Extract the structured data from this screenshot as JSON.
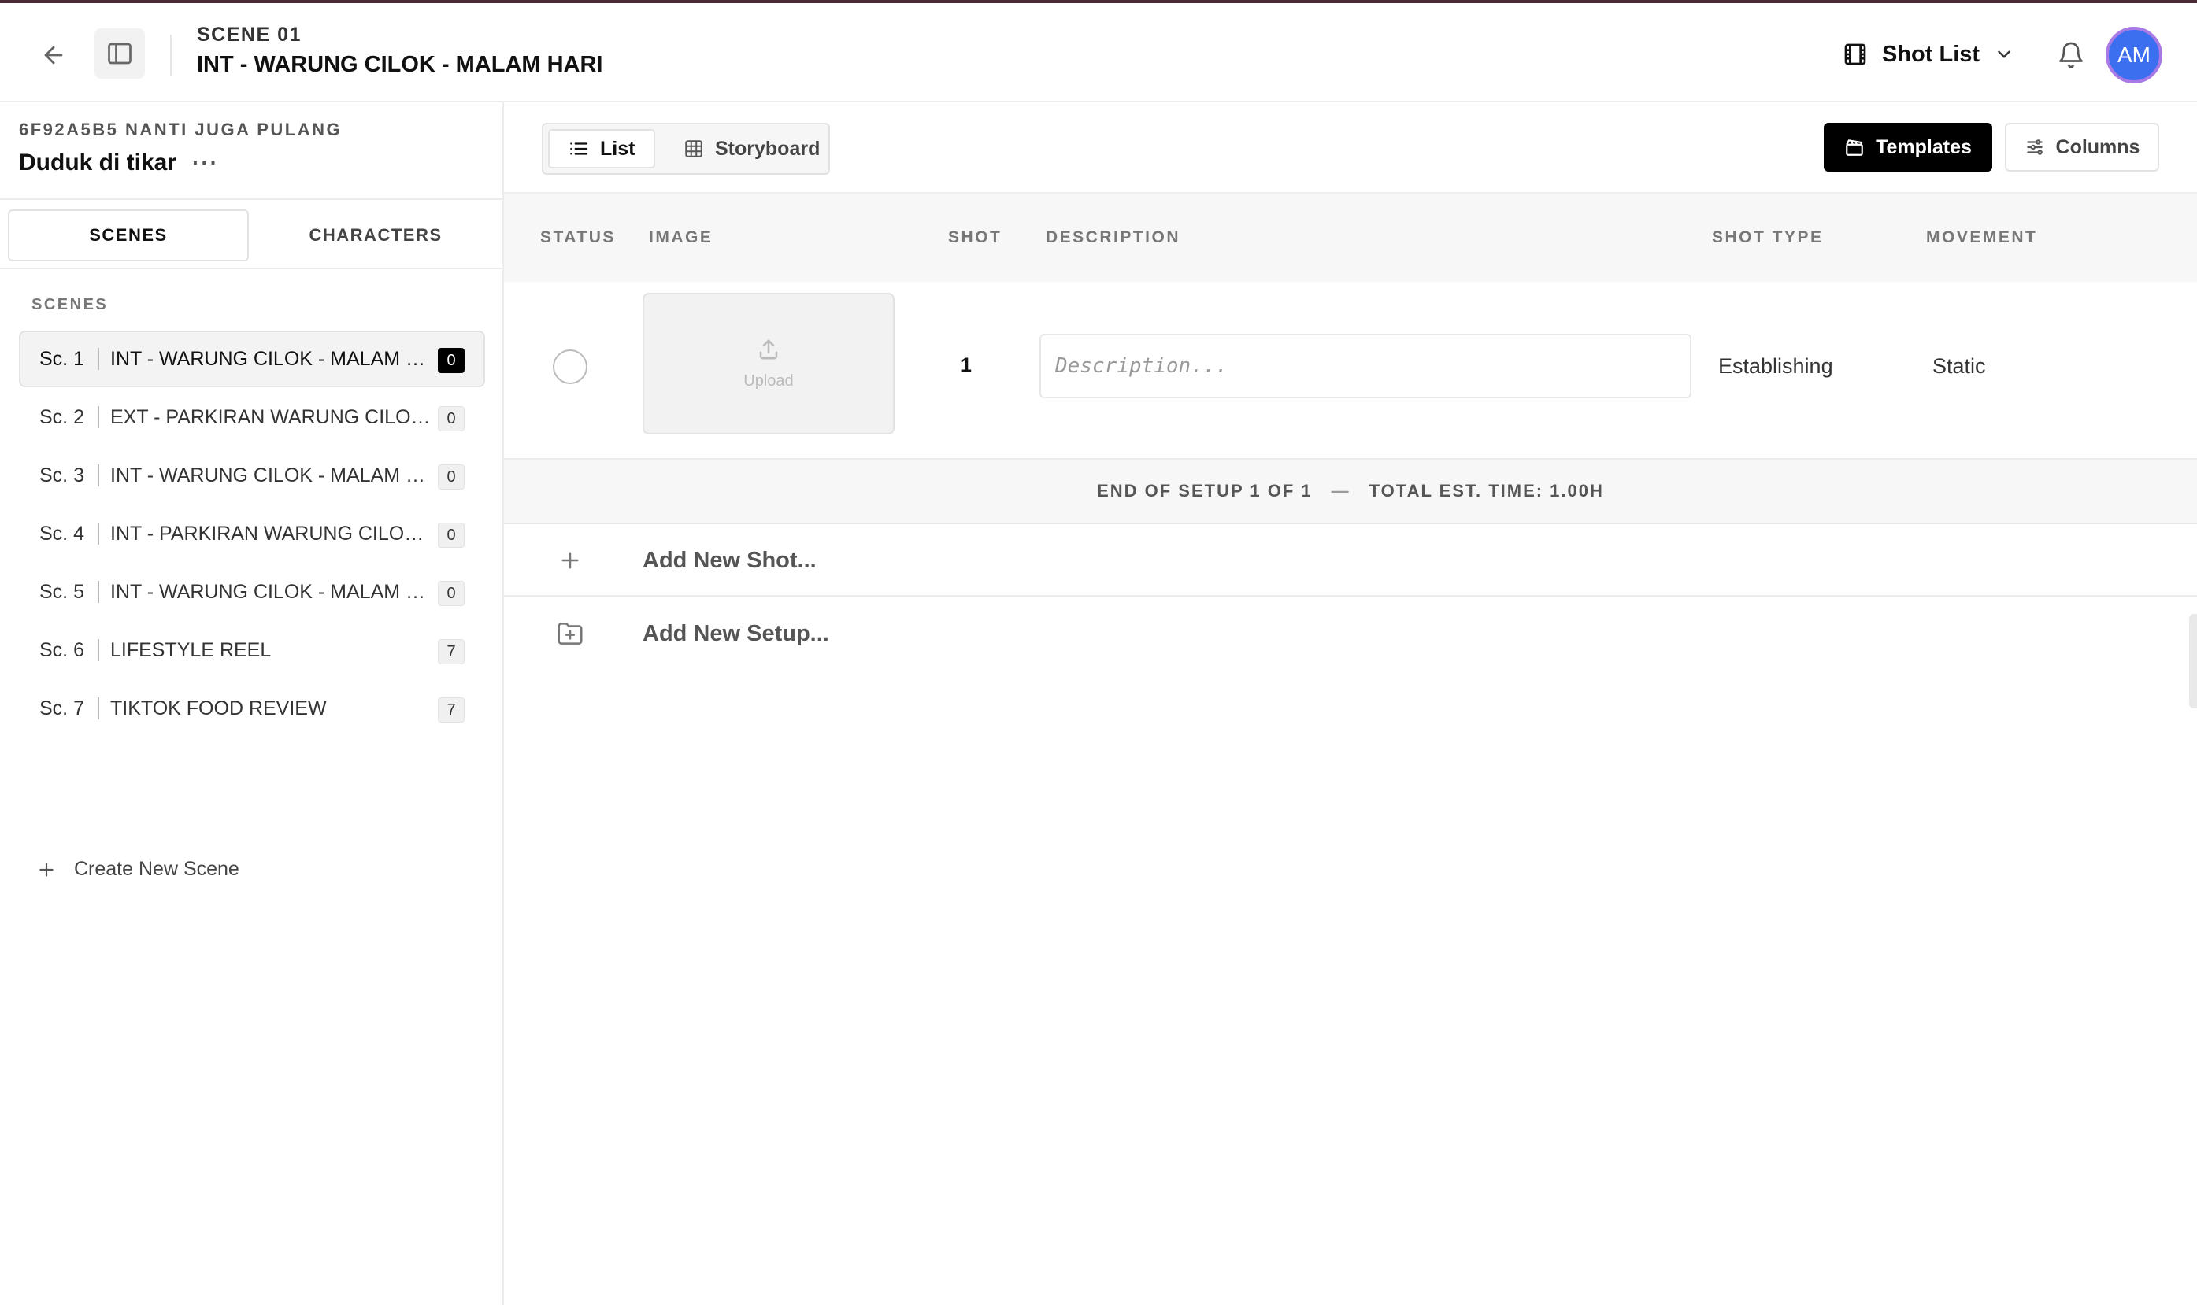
{
  "header": {
    "scene_label": "SCENE 01",
    "scene_heading": "INT - WARUNG CILOK - MALAM HARI",
    "view_dropdown": "Shot List",
    "avatar_initials": "AM"
  },
  "sidebar": {
    "project_id": "6F92A5B5 NANTI JUGA PULANG",
    "project_name": "Duduk di tikar",
    "more": "···",
    "tabs": [
      "SCENES",
      "CHARACTERS"
    ],
    "scenes_caption": "SCENES",
    "scenes": [
      {
        "num": "Sc. 1",
        "title": "INT - WARUNG CILOK - MALAM H...",
        "count": "0"
      },
      {
        "num": "Sc. 2",
        "title": "EXT - PARKIRAN WARUNG CILOT ...",
        "count": "0"
      },
      {
        "num": "Sc. 3",
        "title": "INT - WARUNG CILOK - MALAM H...",
        "count": "0"
      },
      {
        "num": "Sc. 4",
        "title": "INT - PARKIRAN WARUNG CILOK ...",
        "count": "0"
      },
      {
        "num": "Sc. 5",
        "title": "INT - WARUNG CILOK - MALAM H...",
        "count": "0"
      },
      {
        "num": "Sc. 6",
        "title": "LIFESTYLE REEL",
        "count": "7"
      },
      {
        "num": "Sc. 7",
        "title": "TIKTOK FOOD REVIEW",
        "count": "7"
      }
    ],
    "create_scene": "Create New Scene"
  },
  "toolbar": {
    "list_label": "List",
    "storyboard_label": "Storyboard",
    "templates_label": "Templates",
    "columns_label": "Columns"
  },
  "table": {
    "headers": {
      "status": "STATUS",
      "image": "IMAGE",
      "shot": "SHOT",
      "description": "DESCRIPTION",
      "shot_type": "SHOT TYPE",
      "movement": "MOVEMENT"
    },
    "rows": [
      {
        "upload_label": "Upload",
        "shot": "1",
        "description_placeholder": "Description...",
        "shot_type": "Establishing",
        "movement": "Static"
      }
    ],
    "setup_footer_left": "END OF SETUP 1 OF 1",
    "setup_footer_sep": "—",
    "setup_footer_right": "TOTAL EST. TIME: 1.00H",
    "add_shot": "Add New Shot...",
    "add_setup": "Add New Setup..."
  },
  "colors": {
    "accent_black": "#000000",
    "avatar_bg": "#3b6ff0",
    "avatar_ring": "#a87ae6",
    "top_line": "#4a2a35"
  }
}
